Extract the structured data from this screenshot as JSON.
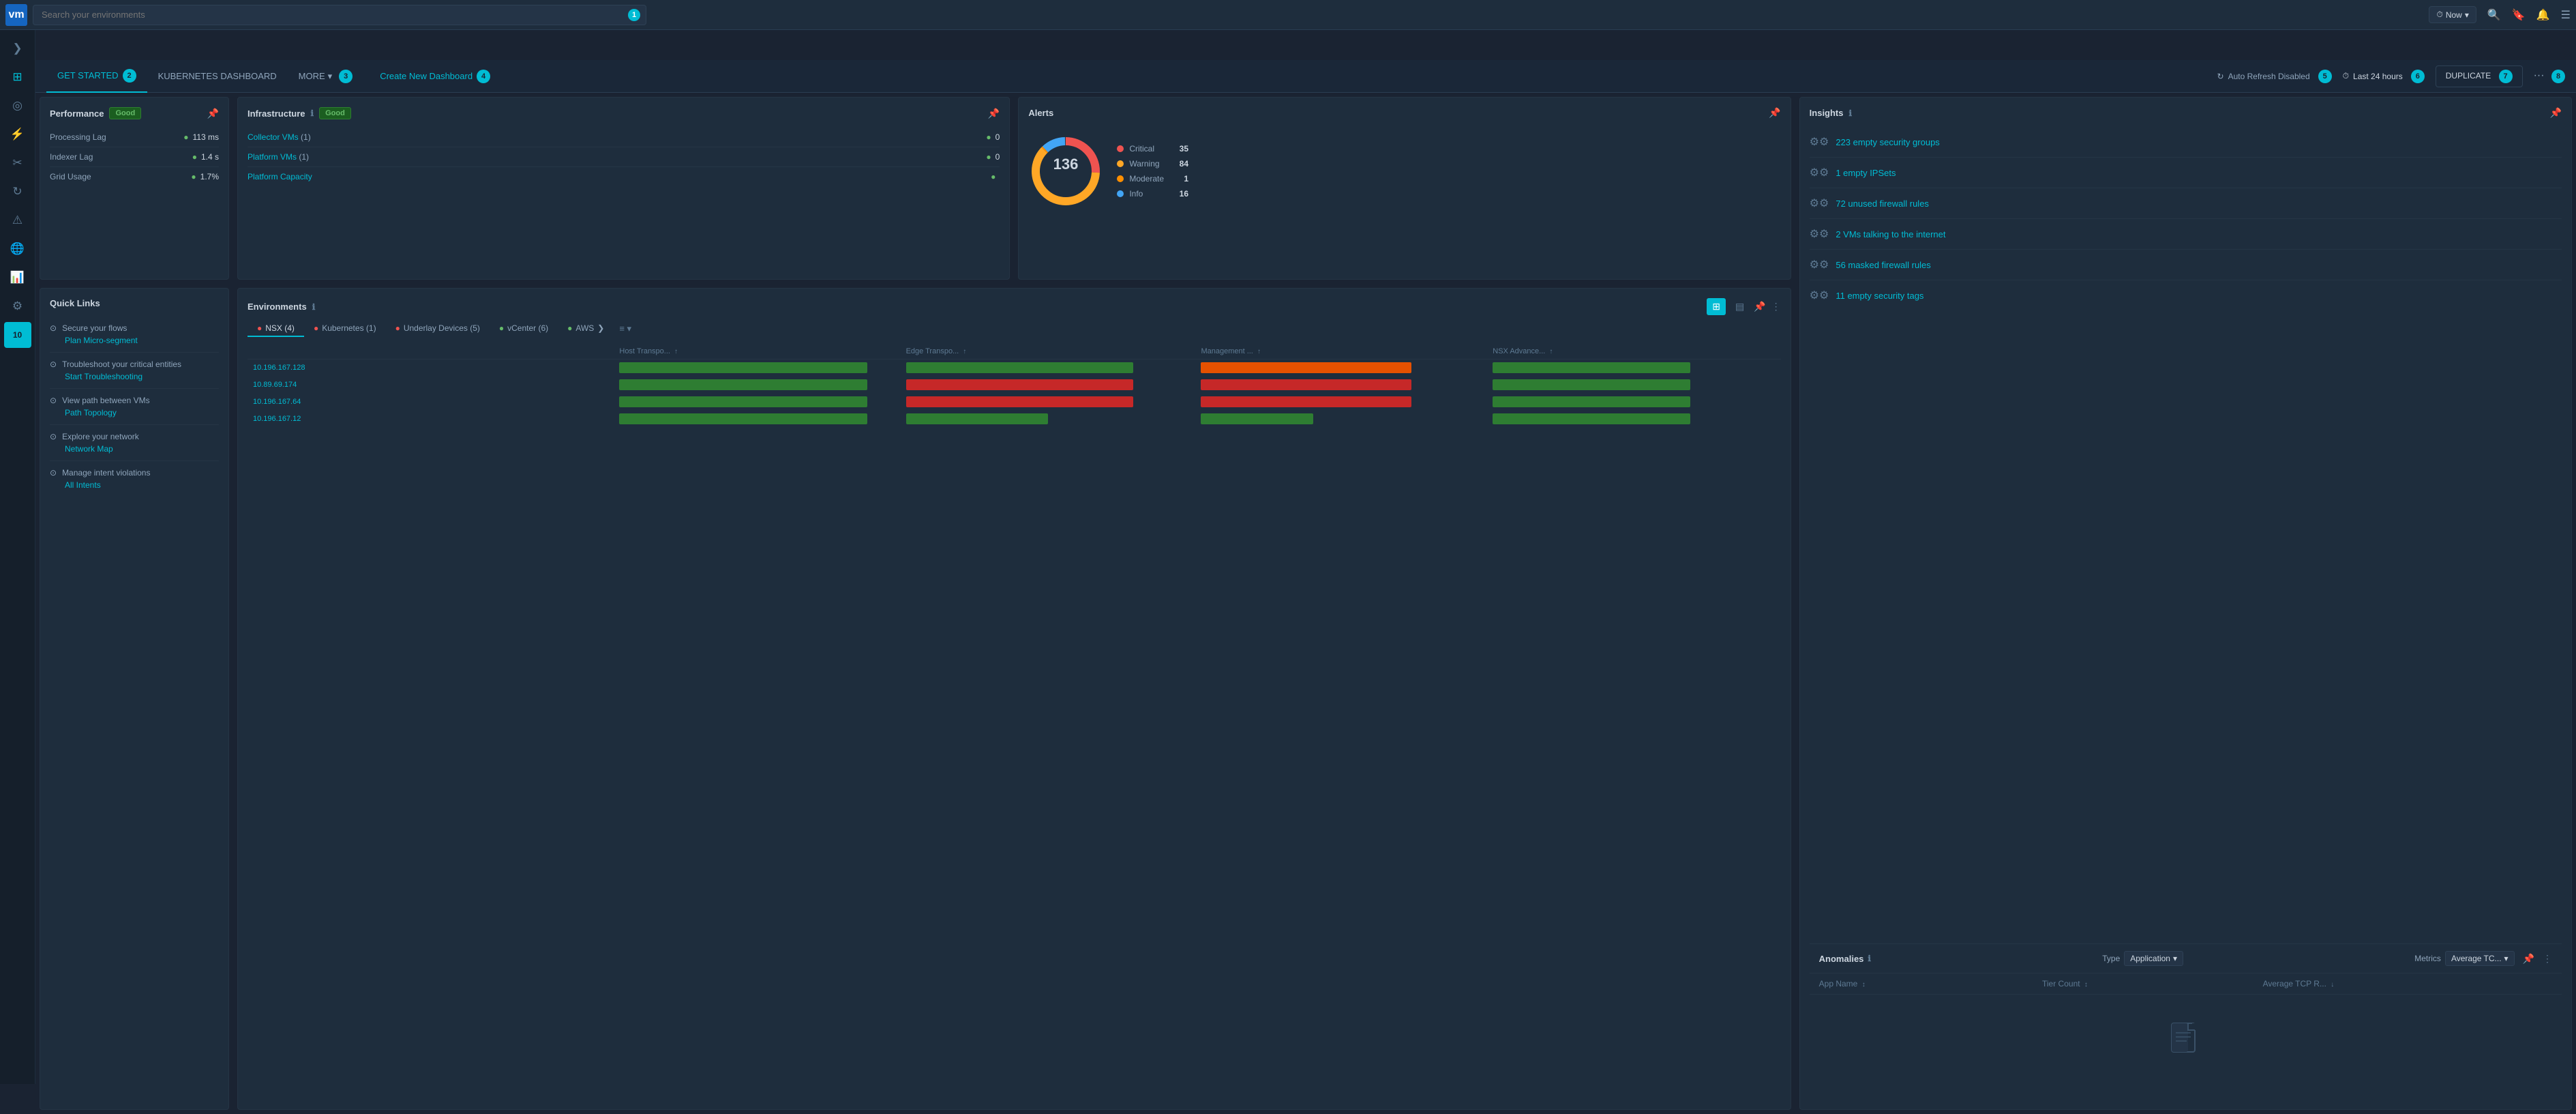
{
  "topnav": {
    "search_placeholder": "Search your environments",
    "search_badge": "1",
    "now_label": "Now",
    "now_chevron": "▾"
  },
  "sidebar": {
    "items": [
      {
        "icon": "≡",
        "label": "expand"
      },
      {
        "icon": "⊞",
        "label": "dashboard"
      },
      {
        "icon": "◎",
        "label": "monitoring"
      },
      {
        "icon": "⚡",
        "label": "alerts"
      },
      {
        "icon": "✂",
        "label": "tools"
      },
      {
        "icon": "↻",
        "label": "refresh"
      },
      {
        "icon": "⚠",
        "label": "warnings"
      },
      {
        "icon": "🌐",
        "label": "network"
      },
      {
        "icon": "📊",
        "label": "analytics"
      },
      {
        "icon": "⚙",
        "label": "settings"
      },
      {
        "icon": "10",
        "label": "badge-10"
      }
    ]
  },
  "tabs": {
    "items": [
      {
        "label": "GET STARTED",
        "active": true,
        "badge": "2"
      },
      {
        "label": "KUBERNETES DASHBOARD",
        "active": false,
        "badge": ""
      },
      {
        "label": "MORE",
        "active": false,
        "badge": "",
        "has_arrow": true,
        "badge_num": "3"
      }
    ],
    "create_label": "Create New Dashboard",
    "tab_badge_2": "2",
    "tab_badge_3": "3",
    "tab_badge_4": "4"
  },
  "tabs_right": {
    "auto_refresh_icon": "↻",
    "auto_refresh_label": "Auto Refresh Disabled",
    "time_icon": "⏱",
    "time_label": "Last 24 hours",
    "duplicate_label": "DUPLICATE",
    "more_label": "···",
    "badge_5": "5",
    "badge_6": "6",
    "badge_7": "7",
    "badge_8": "8"
  },
  "performance": {
    "title": "Performance",
    "badge": "Good",
    "rows": [
      {
        "label": "Processing Lag",
        "value": "113 ms"
      },
      {
        "label": "Indexer Lag",
        "value": "1.4 s"
      },
      {
        "label": "Grid Usage",
        "value": "1.7%"
      }
    ]
  },
  "infrastructure": {
    "title": "Infrastructure",
    "badge": "Good",
    "rows": [
      {
        "label": "Collector VMs",
        "count_label": "(1)",
        "value": "0"
      },
      {
        "label": "Platform VMs",
        "count_label": "(1)",
        "value": "0"
      },
      {
        "label": "Platform Capacity",
        "count_label": "",
        "value": ""
      }
    ]
  },
  "alerts": {
    "title": "Alerts",
    "total": "136",
    "legend": [
      {
        "label": "Critical",
        "value": "35",
        "color": "#ef5350"
      },
      {
        "label": "Warning",
        "value": "84",
        "color": "#ffa726"
      },
      {
        "label": "Moderate",
        "value": "1",
        "color": "#ff8f00"
      },
      {
        "label": "Info",
        "value": "16",
        "color": "#42a5f5"
      }
    ]
  },
  "insights": {
    "title": "Insights",
    "items": [
      {
        "text": "223 empty security groups"
      },
      {
        "text": "1 empty IPSets"
      },
      {
        "text": "72 unused firewall rules"
      },
      {
        "text": "2 VMs talking to the internet"
      },
      {
        "text": "56 masked firewall rules"
      },
      {
        "text": "11 empty security tags"
      }
    ]
  },
  "quicklinks": {
    "title": "Quick Links",
    "items": [
      {
        "title": "Secure your flows",
        "link": "Plan Micro-segment"
      },
      {
        "title": "Troubleshoot your critical entities",
        "link": "Start Troubleshooting"
      },
      {
        "title": "View path between VMs",
        "link": "Path Topology"
      },
      {
        "title": "Explore your network",
        "link": "Network Map"
      },
      {
        "title": "Manage intent violations",
        "link": "All Intents"
      }
    ]
  },
  "environments": {
    "title": "Environments",
    "tabs": [
      {
        "label": "NSX (4)",
        "color": "red",
        "active": true
      },
      {
        "label": "Kubernetes (1)",
        "color": "red",
        "active": false
      },
      {
        "label": "Underlay Devices (5)",
        "color": "red",
        "active": false
      },
      {
        "label": "vCenter (6)",
        "color": "green",
        "active": false
      },
      {
        "label": "AWS",
        "color": "green",
        "active": false
      }
    ],
    "columns": [
      "Host Transpo...↑",
      "Edge Transpo...↑",
      "Management ...↑",
      "NSX Advance...↑"
    ],
    "rows": [
      {
        "ip": "10.196.167.128",
        "bars": [
          "green",
          "green",
          "orange",
          "green"
        ]
      },
      {
        "ip": "10.89.69.174",
        "bars": [
          "green",
          "red",
          "red",
          "green"
        ]
      },
      {
        "ip": "10.196.167.64",
        "bars": [
          "green",
          "red",
          "red",
          "green"
        ]
      },
      {
        "ip": "10.196.167.12",
        "bars": [
          "green",
          "green",
          "green",
          "green"
        ]
      }
    ]
  },
  "anomalies": {
    "title": "Anomalies",
    "type_label": "Type",
    "type_value": "Application",
    "metrics_label": "Metrics",
    "metrics_value": "Average TC...",
    "columns": [
      "App Name",
      "Tier Count",
      "Average TCP R..."
    ],
    "empty_text": ""
  }
}
